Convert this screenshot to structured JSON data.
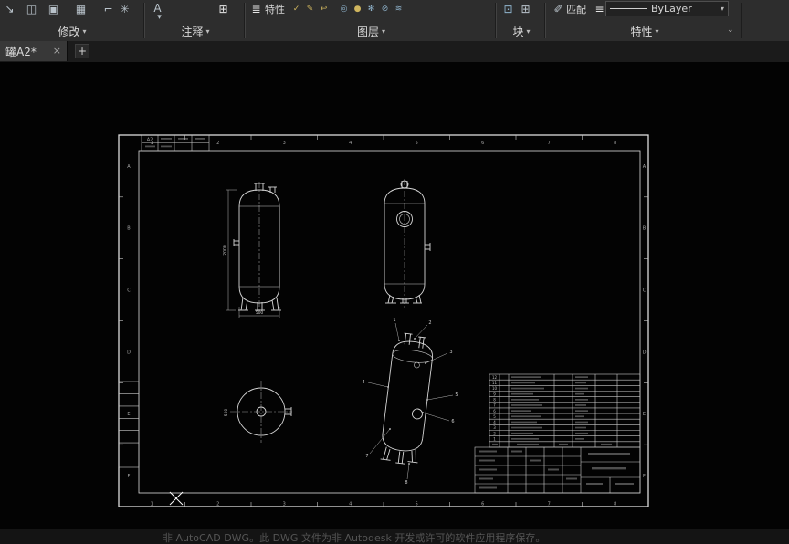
{
  "ribbon": {
    "modify": {
      "label": "修改"
    },
    "annotate": {
      "label": "注释"
    },
    "layers": {
      "label": "图层",
      "properties_button": "特性"
    },
    "block": {
      "label": "块"
    },
    "properties": {
      "label": "特性",
      "match_button": "匹配",
      "linetype_value": "ByLayer"
    }
  },
  "tabbar": {
    "active_tab": "罐A2*"
  },
  "icons": {
    "dropdown": "▾",
    "collapse": "⌄",
    "close": "×",
    "plus": "+",
    "stretch": "↘",
    "mirror": "◫",
    "copy": "▣",
    "array": "▦",
    "fillet": "⌐",
    "explode": "✳",
    "mtext": "A",
    "table": "⊞",
    "layer_properties": "≣",
    "layer_set_current": "✓",
    "layer_match": "✎",
    "layer_prev": "↩",
    "layer_isolate": "◎",
    "layer_off": "●",
    "layer_freeze": "✻",
    "layer_lock": "⊘",
    "layer_merge": "≋",
    "block_insert": "⊡",
    "block_create": "⊞",
    "match_properties": "✐",
    "lineweight": "≡"
  },
  "canvas": {
    "sheet_label": "A2",
    "zone_numbers": [
      "1",
      "2",
      "3",
      "4",
      "5",
      "6",
      "7",
      "8"
    ],
    "zone_letters": [
      "A",
      "B",
      "C",
      "D",
      "E",
      "F"
    ],
    "dimensions": {
      "height": "2000",
      "width": "500",
      "diameter": "500"
    },
    "bom_numbers": [
      "12",
      "11",
      "10",
      "9",
      "8",
      "7",
      "6",
      "5",
      "4",
      "3",
      "2",
      "1"
    ],
    "callouts": [
      "1",
      "2",
      "3",
      "4",
      "5",
      "6",
      "7",
      "8"
    ]
  },
  "statusbar": {
    "warning": "非 AutoCAD DWG。此 DWG 文件为非 Autodesk 开发或许可的软件应用程序保存。"
  }
}
